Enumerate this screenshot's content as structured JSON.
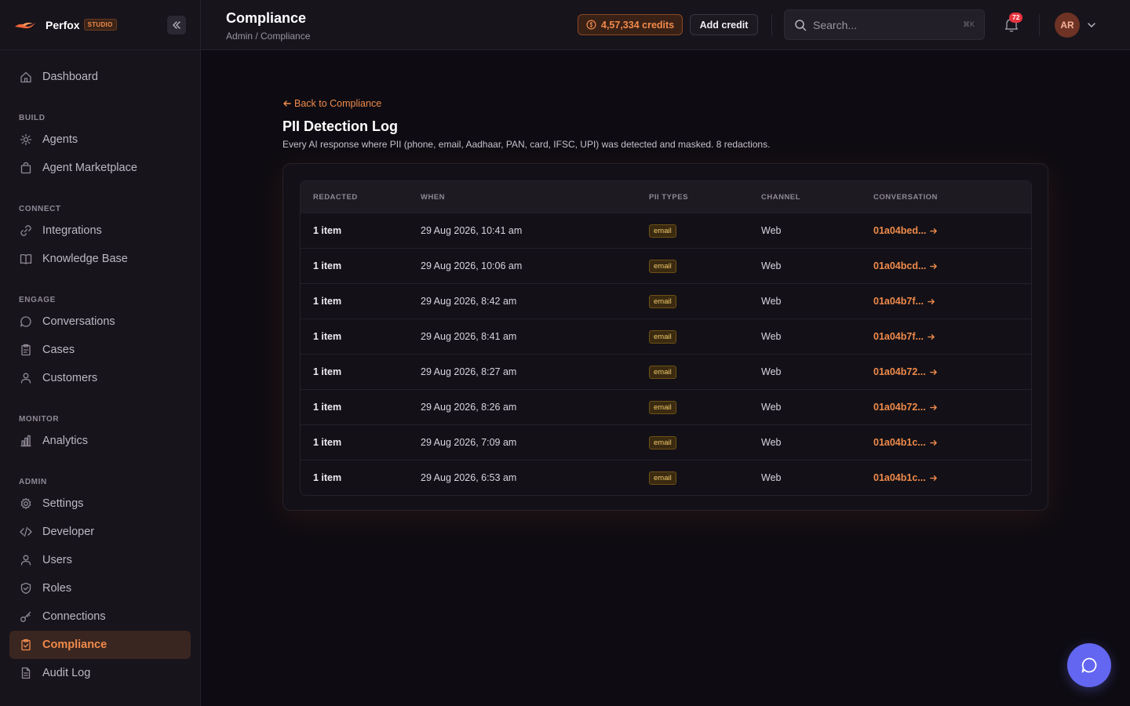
{
  "brand": {
    "name": "Perfox",
    "tag": "STUDIO"
  },
  "sidebar": {
    "top_items": [
      {
        "label": "Dashboard",
        "icon": "home-icon"
      }
    ],
    "sections": [
      {
        "title": "BUILD",
        "items": [
          {
            "label": "Agents",
            "icon": "agent-icon"
          },
          {
            "label": "Agent Marketplace",
            "icon": "bag-icon"
          }
        ]
      },
      {
        "title": "CONNECT",
        "items": [
          {
            "label": "Integrations",
            "icon": "link-icon"
          },
          {
            "label": "Knowledge Base",
            "icon": "book-icon"
          }
        ]
      },
      {
        "title": "ENGAGE",
        "items": [
          {
            "label": "Conversations",
            "icon": "chat-icon"
          },
          {
            "label": "Cases",
            "icon": "clipboard-icon"
          },
          {
            "label": "Customers",
            "icon": "users-icon"
          }
        ]
      },
      {
        "title": "MONITOR",
        "items": [
          {
            "label": "Analytics",
            "icon": "bar-chart-icon"
          }
        ]
      },
      {
        "title": "ADMIN",
        "items": [
          {
            "label": "Settings",
            "icon": "gear-icon"
          },
          {
            "label": "Developer",
            "icon": "code-icon"
          },
          {
            "label": "Users",
            "icon": "user-icon"
          },
          {
            "label": "Roles",
            "icon": "shield-icon"
          },
          {
            "label": "Connections",
            "icon": "key-icon"
          },
          {
            "label": "Compliance",
            "icon": "clipboard-check-icon",
            "active": true
          },
          {
            "label": "Audit Log",
            "icon": "file-icon"
          }
        ]
      }
    ]
  },
  "header": {
    "title": "Compliance",
    "breadcrumb": "Admin / Compliance",
    "credits": "4,57,334 credits",
    "add_credit": "Add credit",
    "search_placeholder": "Search...",
    "search_shortcut": "⌘K",
    "notification_count": "72",
    "avatar_initials": "AR"
  },
  "main": {
    "back_link": "Back to Compliance",
    "title": "PII Detection Log",
    "description": "Every AI response where PII (phone, email, Aadhaar, PAN, card, IFSC, UPI) was detected and masked. 8 redactions.",
    "columns": [
      "REDACTED",
      "WHEN",
      "PII TYPES",
      "CHANNEL",
      "CONVERSATION"
    ],
    "rows": [
      {
        "redacted": "1 item",
        "when": "29 Aug 2026, 10:41 am",
        "pii": "email",
        "channel": "Web",
        "conversation": "01a04bed..."
      },
      {
        "redacted": "1 item",
        "when": "29 Aug 2026, 10:06 am",
        "pii": "email",
        "channel": "Web",
        "conversation": "01a04bcd..."
      },
      {
        "redacted": "1 item",
        "when": "29 Aug 2026, 8:42 am",
        "pii": "email",
        "channel": "Web",
        "conversation": "01a04b7f..."
      },
      {
        "redacted": "1 item",
        "when": "29 Aug 2026, 8:41 am",
        "pii": "email",
        "channel": "Web",
        "conversation": "01a04b7f..."
      },
      {
        "redacted": "1 item",
        "when": "29 Aug 2026, 8:27 am",
        "pii": "email",
        "channel": "Web",
        "conversation": "01a04b72..."
      },
      {
        "redacted": "1 item",
        "when": "29 Aug 2026, 8:26 am",
        "pii": "email",
        "channel": "Web",
        "conversation": "01a04b72..."
      },
      {
        "redacted": "1 item",
        "when": "29 Aug 2026, 7:09 am",
        "pii": "email",
        "channel": "Web",
        "conversation": "01a04b1c..."
      },
      {
        "redacted": "1 item",
        "when": "29 Aug 2026, 6:53 am",
        "pii": "email",
        "channel": "Web",
        "conversation": "01a04b1c..."
      }
    ]
  },
  "colors": {
    "accent": "#f08a4b",
    "background": "#0e0c12",
    "sidebar": "#17141c",
    "chat_button": "#6366f1"
  }
}
